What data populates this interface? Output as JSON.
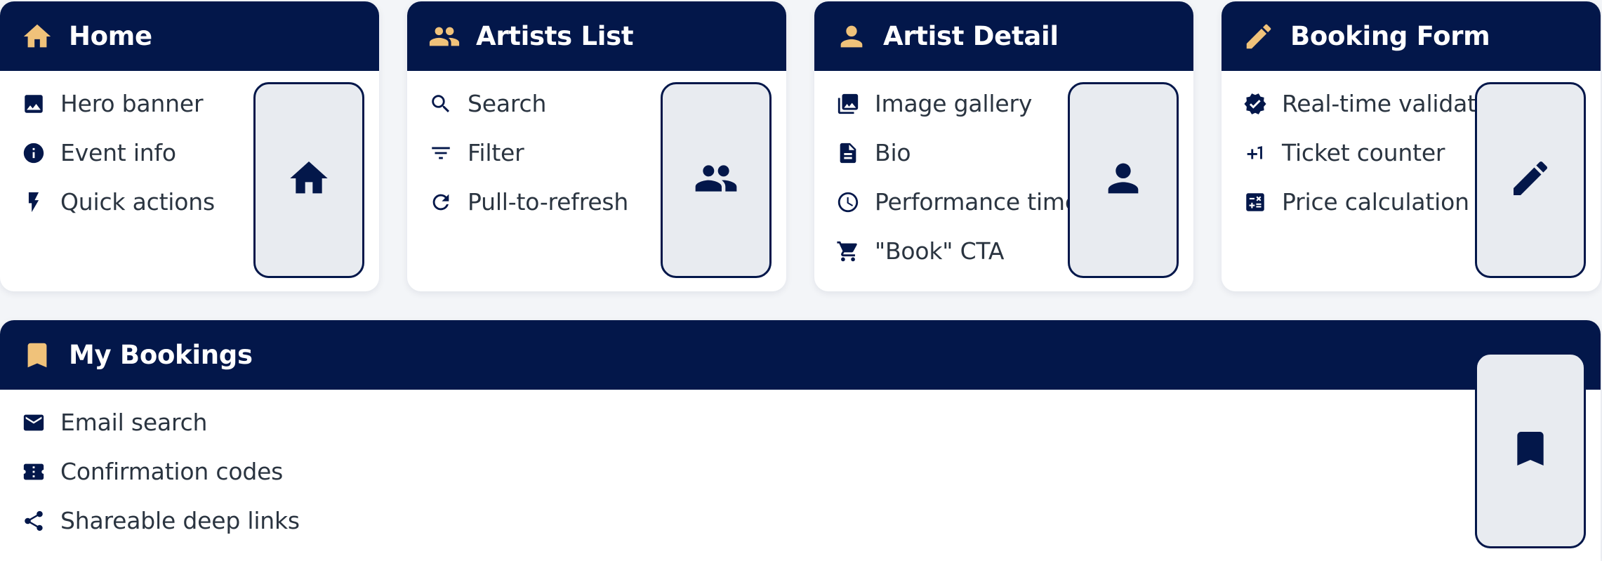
{
  "colors": {
    "navy": "#03174a",
    "accent": "#f0c27a",
    "card_bg": "#ffffff",
    "page_bg": "#f3f5f8",
    "phone_bg": "#e8ebf0"
  },
  "screens": [
    {
      "title": "Home",
      "icon": "home-icon",
      "features": [
        {
          "icon": "image-icon",
          "label": "Hero banner"
        },
        {
          "icon": "info-icon",
          "label": "Event info"
        },
        {
          "icon": "bolt-icon",
          "label": "Quick actions"
        }
      ],
      "phone_icon": "home-icon"
    },
    {
      "title": "Artists List",
      "icon": "people-icon",
      "features": [
        {
          "icon": "search-icon",
          "label": "Search"
        },
        {
          "icon": "filter-icon",
          "label": "Filter"
        },
        {
          "icon": "refresh-icon",
          "label": "Pull-to-refresh"
        }
      ],
      "phone_icon": "people-icon"
    },
    {
      "title": "Artist Detail",
      "icon": "person-icon",
      "features": [
        {
          "icon": "gallery-icon",
          "label": "Image gallery"
        },
        {
          "icon": "document-icon",
          "label": "Bio"
        },
        {
          "icon": "clock-icon",
          "label": "Performance time"
        },
        {
          "icon": "cart-icon",
          "label": "\"Book\" CTA"
        }
      ],
      "phone_icon": "person-icon"
    },
    {
      "title": "Booking Form",
      "icon": "pencil-icon",
      "features": [
        {
          "icon": "verified-icon",
          "label": "Real-time validation"
        },
        {
          "icon": "plus-one-icon",
          "label": "Ticket counter"
        },
        {
          "icon": "calculator-icon",
          "label": "Price calculation"
        }
      ],
      "phone_icon": "pencil-icon"
    },
    {
      "title": "My Bookings",
      "icon": "bookmark-icon",
      "features": [
        {
          "icon": "email-icon",
          "label": "Email search"
        },
        {
          "icon": "ticket-icon",
          "label": "Confirmation codes"
        },
        {
          "icon": "share-icon",
          "label": "Shareable deep links"
        }
      ],
      "phone_icon": "bookmark-icon"
    }
  ]
}
